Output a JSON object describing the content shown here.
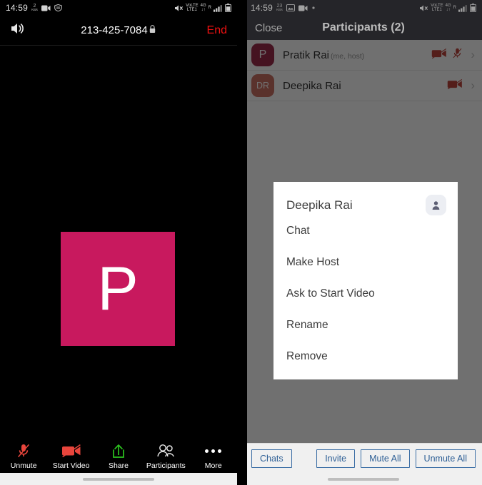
{
  "left": {
    "statusbar": {
      "time": "14:59",
      "data_rate_value": "2",
      "data_rate_unit": "KB/s",
      "icons": [
        "video-camera-icon",
        "shield-icon"
      ],
      "right_icons": [
        "mute-icon",
        "volte-icon",
        "4g-icon",
        "roaming-icon",
        "signal-icon",
        "battery-icon"
      ],
      "volte_label": "VoLTE",
      "network_label": "4G",
      "roaming_label": "R"
    },
    "call_header": {
      "speaker_icon": "speaker-icon",
      "phone_number": "213-425-7084",
      "lock_icon": "lock-icon",
      "end_label": "End"
    },
    "stage": {
      "avatar_letter": "P",
      "avatar_color": "#c8195e"
    },
    "toolbar": [
      {
        "label": "Unmute",
        "icon": "mic-muted-icon"
      },
      {
        "label": "Start Video",
        "icon": "video-off-icon"
      },
      {
        "label": "Share",
        "icon": "share-upload-icon"
      },
      {
        "label": "Participants",
        "icon": "participants-icon"
      },
      {
        "label": "More",
        "icon": "more-dots-icon"
      }
    ]
  },
  "right": {
    "statusbar": {
      "time": "14:59",
      "data_rate_value": "23",
      "data_rate_unit": "KB/s",
      "icons": [
        "image-icon",
        "video-camera-icon",
        "dot-icon"
      ],
      "volte_label": "VoLTE",
      "network_label": "4G",
      "roaming_label": "R"
    },
    "header": {
      "close_label": "Close",
      "title": "Participants (2)"
    },
    "participants": [
      {
        "initials": "P",
        "name": "Pratik Rai",
        "subtitle": "(me, host)",
        "avatar_color": "#8e1236",
        "video_icon": "video-off-icon",
        "mic_icon": "mic-muted-icon",
        "chevron": "chevron-right-icon"
      },
      {
        "initials": "DR",
        "name": "Deepika Rai",
        "subtitle": "",
        "avatar_color": "#c45f52",
        "video_icon": "video-off-icon",
        "mic_icon": "",
        "chevron": "chevron-right-icon"
      }
    ],
    "dialog": {
      "title": "Deepika Rai",
      "badge_icon": "person-icon",
      "items": [
        "Chat",
        "Make Host",
        "Ask to Start Video",
        "Rename",
        "Remove"
      ]
    },
    "actions": {
      "chats_label": "Chats",
      "invite_label": "Invite",
      "mute_all_label": "Mute All",
      "unmute_all_label": "Unmute All"
    }
  }
}
